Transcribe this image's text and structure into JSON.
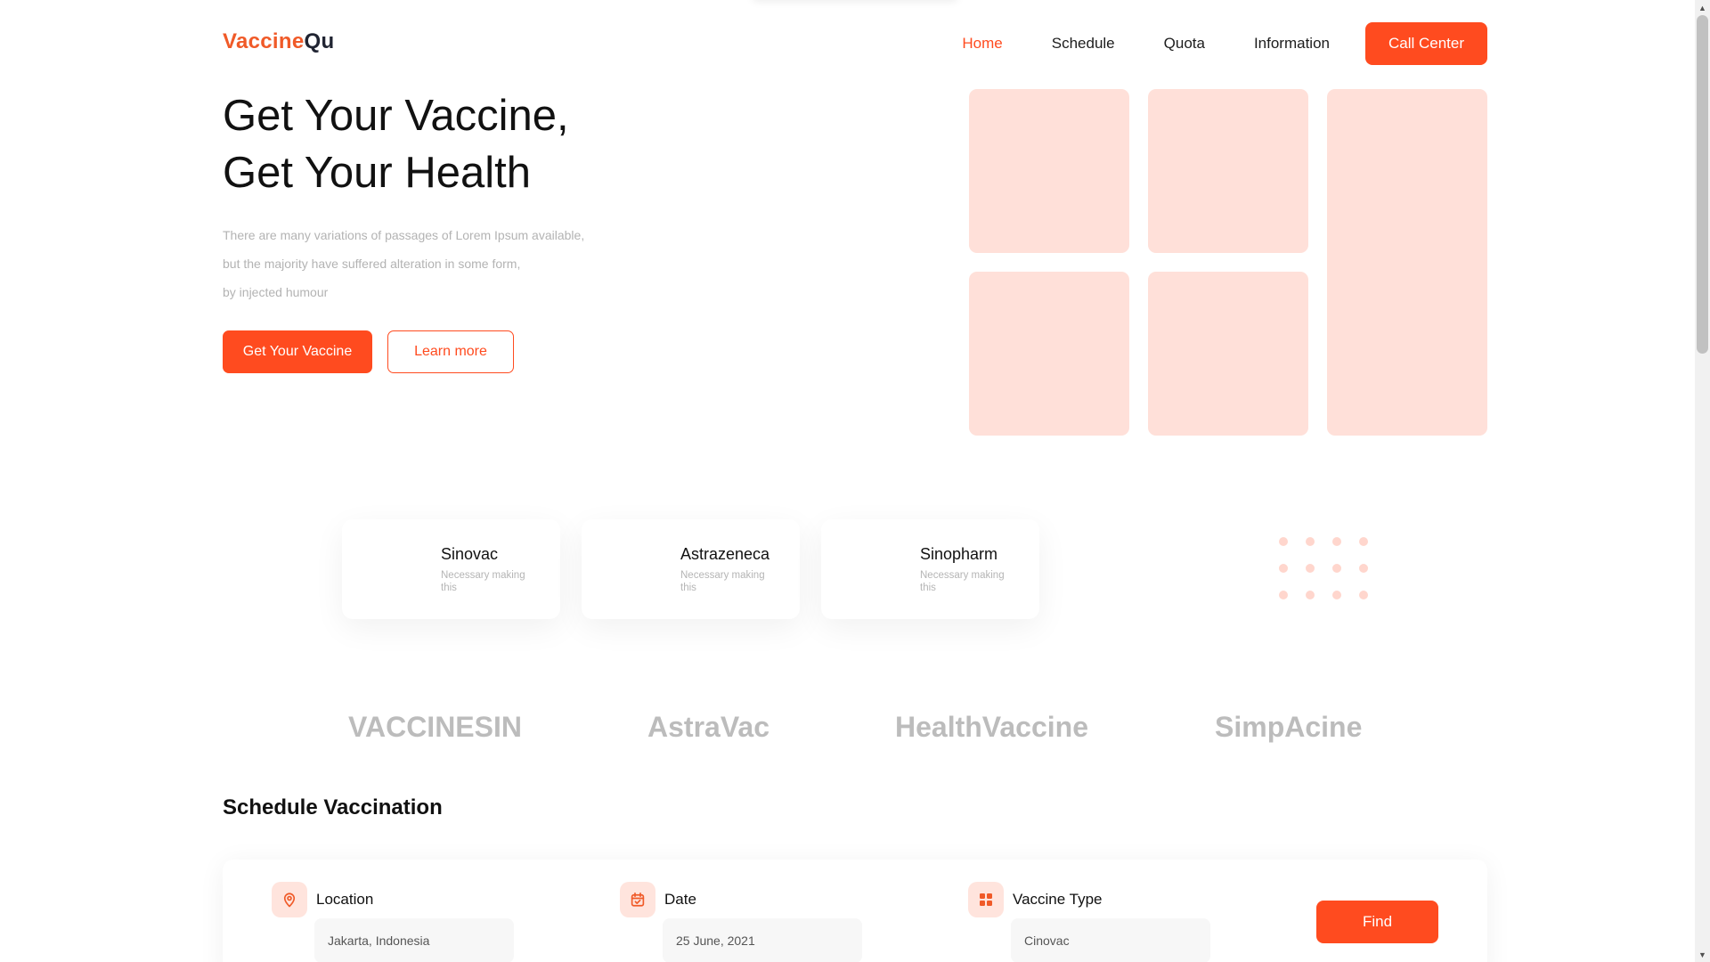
{
  "brand": {
    "part1": "Vaccine",
    "part2": "Qu"
  },
  "nav": {
    "items": [
      {
        "label": "Home",
        "active": true
      },
      {
        "label": "Schedule",
        "active": false
      },
      {
        "label": "Quota",
        "active": false
      },
      {
        "label": "Information",
        "active": false
      }
    ],
    "cta_label": "Call Center"
  },
  "hero": {
    "title_line1": "Get Your Vaccine,",
    "title_line2": "Get Your Health",
    "desc_lines": [
      "There are many variations of passages of Lorem Ipsum available,",
      "but the majority have suffered alteration in some form,",
      "by injected humour"
    ],
    "primary_button": "Get Your Vaccine",
    "secondary_button": "Learn more"
  },
  "vaccines": [
    {
      "name": "Sinovac",
      "desc": "Necessary making this"
    },
    {
      "name": "Astrazeneca",
      "desc": "Necessary making this"
    },
    {
      "name": "Sinopharm",
      "desc": "Necessary making this"
    }
  ],
  "partners": [
    "VACCINESIN",
    "AstraVac",
    "HealthVaccine",
    "SimpAcine"
  ],
  "schedule": {
    "title": "Schedule Vaccination",
    "fields": [
      {
        "label": "Location",
        "value": "Jakarta, Indonesia",
        "icon": "location-pin-icon"
      },
      {
        "label": "Date",
        "value": "25 June, 2021",
        "icon": "calendar-icon"
      },
      {
        "label": "Vaccine Type",
        "value": "Cinovac",
        "icon": "grid-icon"
      }
    ],
    "find_button": "Find"
  },
  "colors": {
    "accent": "#ff4b1f",
    "tile": "#ffe0d9",
    "muted_text": "#b3b3b3"
  }
}
